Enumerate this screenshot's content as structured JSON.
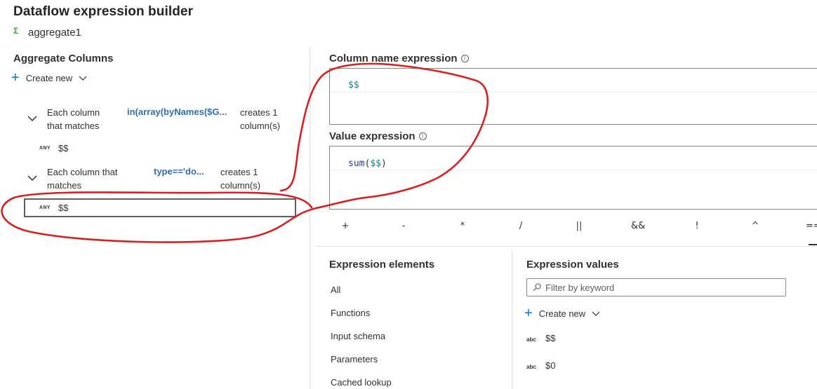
{
  "title": "Dataflow expression builder",
  "transform": {
    "icon": "aggregate-sigma-icon",
    "icon_glyph": "Σ",
    "name": "aggregate1"
  },
  "aggregate_columns": {
    "heading": "Aggregate Columns",
    "create_new_label": "Create new",
    "rules": [
      {
        "line1": "Each column",
        "line2": "that matches",
        "expression": "in(array(byNames($G...",
        "result_line1": "creates 1",
        "result_line2": "column(s)",
        "type_tag": "ANY",
        "column_name": "$$"
      },
      {
        "line1": "Each column that",
        "line2": "matches",
        "expression": "type=='do...",
        "result_line1": "creates 1",
        "result_line2": "column(s)",
        "type_tag": "ANY",
        "column_name": "$$"
      }
    ]
  },
  "column_name_expression": {
    "label": "Column name expression",
    "code": "$$"
  },
  "value_expression": {
    "label": "Value expression",
    "code_fn": "sum",
    "code_open": "(",
    "code_arg": "$$",
    "code_close": ")"
  },
  "operators": [
    "+",
    "-",
    "*",
    "/",
    "||",
    "&&",
    "!",
    "^",
    "=="
  ],
  "expression_elements": {
    "heading": "Expression elements",
    "items": [
      "All",
      "Functions",
      "Input schema",
      "Parameters",
      "Cached lookup"
    ]
  },
  "expression_values": {
    "heading": "Expression values",
    "filter_placeholder": "Filter by keyword",
    "create_new_label": "Create new",
    "items": [
      {
        "type_tag": "abc",
        "name": "$$"
      },
      {
        "type_tag": "abc",
        "name": "$0"
      }
    ]
  },
  "colors": {
    "accent": "#0078d4",
    "annotation": "#d91f1f",
    "expression_link": "#2f6fb3"
  }
}
